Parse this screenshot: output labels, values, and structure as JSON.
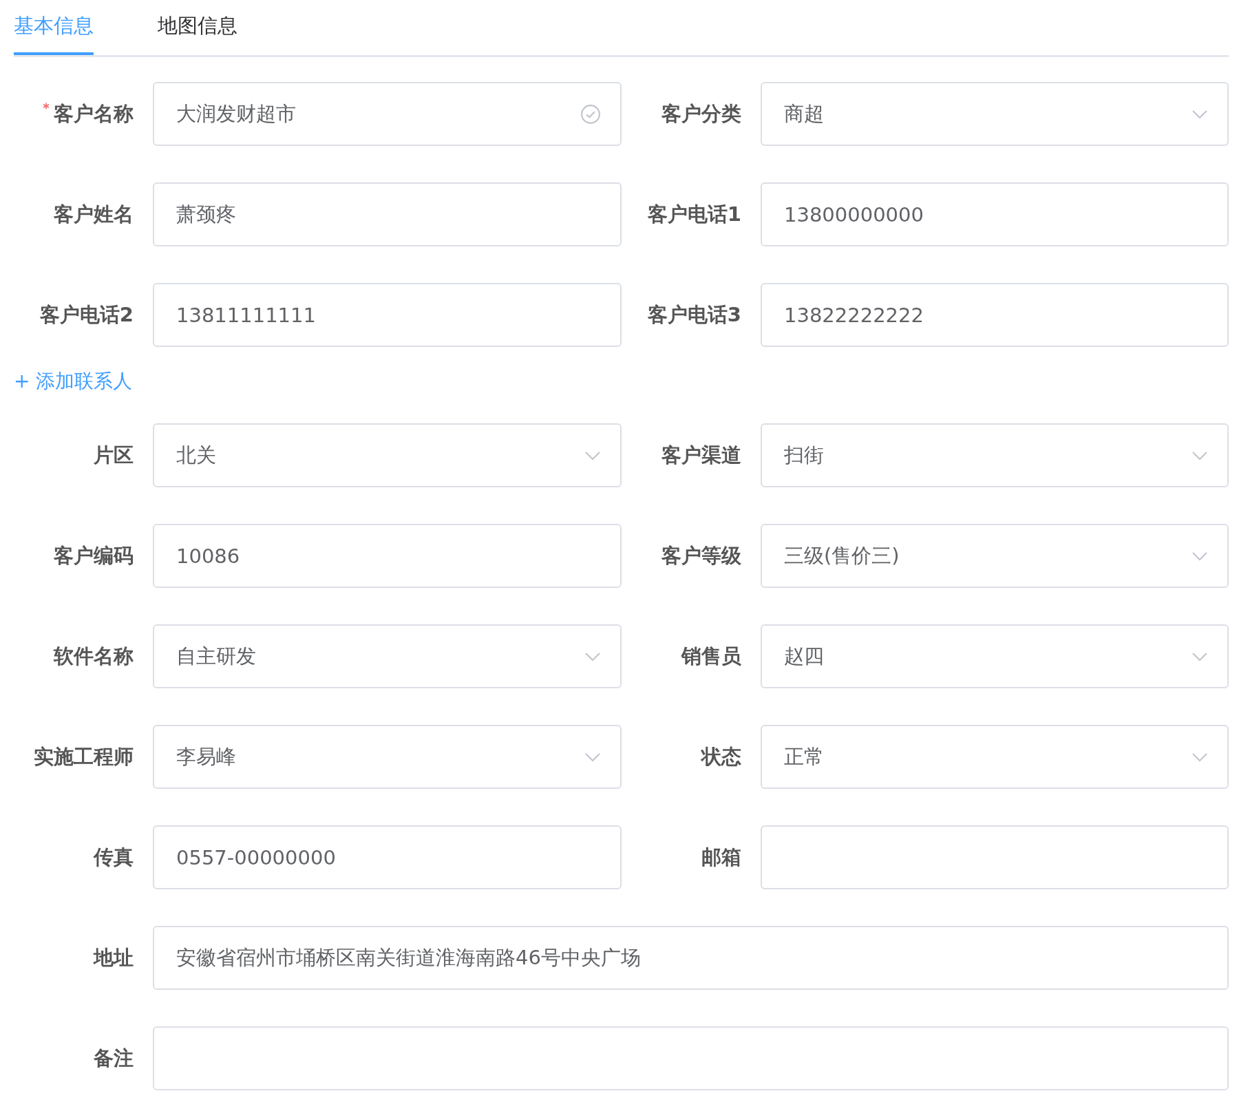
{
  "tabs": [
    {
      "label": "基本信息",
      "selected": true
    },
    {
      "label": "地图信息",
      "selected": false
    }
  ],
  "form": [
    {
      "kind": "row",
      "fields": [
        {
          "label": "客户名称",
          "kind": "input",
          "value": "大润发财超市",
          "required": true,
          "validated": true
        },
        {
          "label": "客户分类",
          "kind": "select",
          "value": "商超",
          "required": false,
          "validated": false
        }
      ]
    },
    {
      "kind": "row",
      "fields": [
        {
          "label": "客户姓名",
          "kind": "input",
          "value": "萧颈疼",
          "required": false,
          "validated": false
        },
        {
          "label": "客户电话1",
          "kind": "input",
          "value": "13800000000",
          "required": false,
          "validated": false
        }
      ]
    },
    {
      "kind": "row",
      "fields": [
        {
          "label": "客户电话2",
          "kind": "input",
          "value": "13811111111",
          "required": false,
          "validated": false
        },
        {
          "label": "客户电话3",
          "kind": "input",
          "value": "13822222222",
          "required": false,
          "validated": false
        }
      ]
    },
    {
      "kind": "link",
      "text": "+ 添加联系人"
    },
    {
      "kind": "row",
      "fields": [
        {
          "label": "片区",
          "kind": "select",
          "value": "北关",
          "required": false,
          "validated": false
        },
        {
          "label": "客户渠道",
          "kind": "select",
          "value": "扫街",
          "required": false,
          "validated": false
        }
      ]
    },
    {
      "kind": "row",
      "fields": [
        {
          "label": "客户编码",
          "kind": "input",
          "value": "10086",
          "required": false,
          "validated": false
        },
        {
          "label": "客户等级",
          "kind": "select",
          "value": "三级(售价三)",
          "required": false,
          "validated": false
        }
      ]
    },
    {
      "kind": "row",
      "fields": [
        {
          "label": "软件名称",
          "kind": "select",
          "value": "自主研发",
          "required": false,
          "validated": false
        },
        {
          "label": "销售员",
          "kind": "select",
          "value": "赵四",
          "required": false,
          "validated": false
        }
      ]
    },
    {
      "kind": "row",
      "fields": [
        {
          "label": "实施工程师",
          "kind": "select",
          "value": "李易峰",
          "required": false,
          "validated": false
        },
        {
          "label": "状态",
          "kind": "select",
          "value": "正常",
          "required": false,
          "validated": false
        }
      ]
    },
    {
      "kind": "row",
      "fields": [
        {
          "label": "传真",
          "kind": "input",
          "value": "0557-00000000",
          "required": false,
          "validated": false
        },
        {
          "label": "邮箱",
          "kind": "input",
          "required": false,
          "validated": false
        }
      ]
    },
    {
      "kind": "row",
      "fields": [
        {
          "label": "地址",
          "kind": "input",
          "value": "安徽省宿州市埇桥区南关街道淮海南路46号中央广场",
          "required": false,
          "validated": false
        }
      ]
    },
    {
      "kind": "row",
      "fields": [
        {
          "label": "备注",
          "kind": "input",
          "required": false,
          "validated": false
        }
      ]
    }
  ]
}
